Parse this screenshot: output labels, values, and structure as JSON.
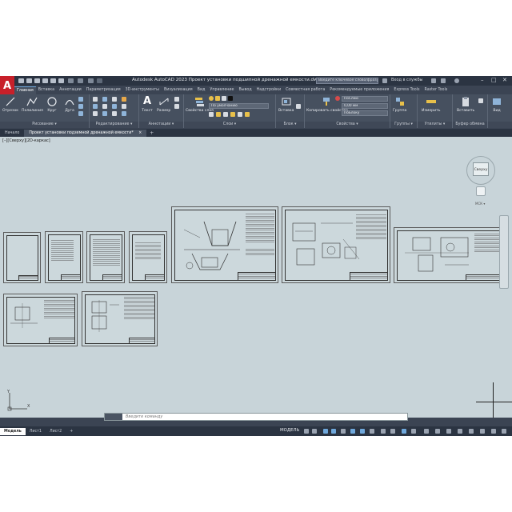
{
  "window": {
    "app_logo": "A",
    "title": "Autodesk AutoCAD 2023   Проект установки подшипной дренажной емкости.dwg",
    "search_placeholder": "Введите ключевое слово/фразу",
    "login": "Вход в службы",
    "minimize": "–",
    "maximize": "□",
    "close": "✕"
  },
  "ribbon_tabs": [
    "Главная",
    "Вставка",
    "Аннотации",
    "Параметризация",
    "3D-инструменты",
    "Визуализация",
    "Вид",
    "Управление",
    "Вывод",
    "Надстройки",
    "Совместная работа",
    "Рекомендуемые приложения",
    "Express Tools",
    "Raster Tools"
  ],
  "active_ribbon_tab": 0,
  "ribbon": {
    "panels": [
      {
        "title": "Рисование ▾",
        "tools": [
          "Отрезок",
          "Полилиния",
          "Круг",
          "Дуга"
        ]
      },
      {
        "title": "Редактирование ▾"
      },
      {
        "title": "Аннотации ▾",
        "tools": [
          "Текст",
          "Размер"
        ]
      },
      {
        "title": "Слои ▾",
        "tools": [
          "Свойства слоя"
        ],
        "layer_combo": "По умолчанию"
      },
      {
        "title": "Блок ▾",
        "tools": [
          "Вставка"
        ]
      },
      {
        "title": "Свойства ▾",
        "tools": [
          "Копировать свойства"
        ],
        "combos": [
          "ПоСлою",
          "0,00 мм",
          "ПоБлоку"
        ]
      },
      {
        "title": "Группы ▾",
        "tools": [
          "Группа"
        ]
      },
      {
        "title": "Утилиты ▾",
        "tools": [
          "Измерить"
        ]
      },
      {
        "title": "Буфер обмена",
        "tools": [
          "Вставить"
        ]
      },
      {
        "title": "",
        "tools": [
          "Вид"
        ]
      }
    ]
  },
  "file_tabs": [
    {
      "label": "Начало",
      "active": false
    },
    {
      "label": "Проект установки подземной дренажной емкости*",
      "active": true
    }
  ],
  "file_tab_close": "×",
  "file_tab_add": "+",
  "canvas": {
    "view_label": "[–][Сверху][2D-каркас]",
    "viewcube_face": "Сверху",
    "viewcube_label": "МСК ▾",
    "ucs_x": "X",
    "ucs_y": "Y"
  },
  "command_line": {
    "prompt": "Введите команду"
  },
  "status": {
    "layout_tabs": [
      "Модель",
      "Лист1",
      "Лист2"
    ],
    "active_layout": 0,
    "add_layout": "+",
    "model_label": "МОДЕЛЬ"
  },
  "colors": {
    "accent": "#6fa8dc",
    "logo": "#c8202a",
    "canvas": "#c8d4d9"
  }
}
